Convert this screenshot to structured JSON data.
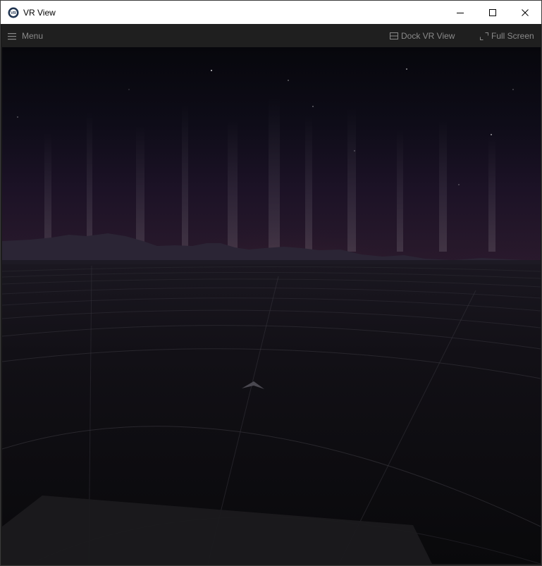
{
  "window": {
    "title": "VR View",
    "controls": [
      "minimize",
      "maximize",
      "close"
    ]
  },
  "toolbar": {
    "menu_label": "Menu",
    "dock_label": "Dock VR View",
    "fullscreen_label": "Full Screen"
  },
  "icons": {
    "app": "vr-logo-icon",
    "menu": "hamburger-icon",
    "dock": "dock-window-icon",
    "fullscreen": "expand-icon"
  },
  "colors": {
    "titlebar": "#ffffff",
    "toolbar": "#1f1f1f",
    "toolbar_text": "#8a8a8a",
    "sky_top": "#07070c",
    "aurora_orange": "#c25a3c",
    "aurora_violet": "#6a2a6a",
    "ground": "#0e0d10"
  }
}
